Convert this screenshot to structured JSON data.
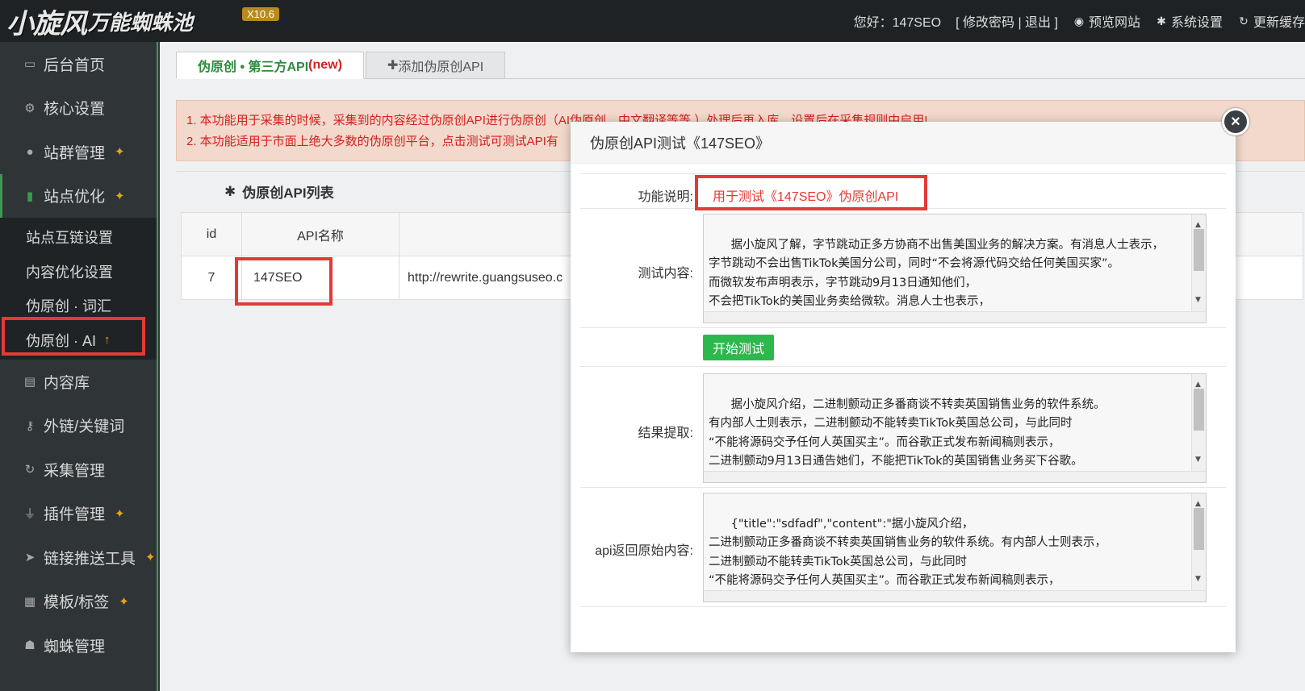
{
  "header": {
    "logo_main": "小旋风",
    "logo_sub": "万能蜘蛛池",
    "version": "X10.6",
    "greeting": "您好：147SEO",
    "account_links": "[ 修改密码 | 退出 ]",
    "preview": "预览网站",
    "settings": "系统设置",
    "refresh": "更新缓存"
  },
  "sidebar": {
    "items": [
      {
        "label": "后台首页",
        "icon": "monitor-icon"
      },
      {
        "label": "核心设置",
        "icon": "gear-icon"
      },
      {
        "label": "站群管理",
        "icon": "user-icon",
        "pinned": true
      },
      {
        "label": "站点优化",
        "icon": "bar-chart-icon",
        "pinned": true
      },
      {
        "label": "内容库",
        "icon": "document-icon"
      },
      {
        "label": "外链/关键词",
        "icon": "key-icon"
      },
      {
        "label": "采集管理",
        "icon": "refresh-icon"
      },
      {
        "label": "插件管理",
        "icon": "plug-icon",
        "pinned": true
      },
      {
        "label": "链接推送工具",
        "icon": "send-icon",
        "pinned": true
      },
      {
        "label": "模板/标签",
        "icon": "windows-icon",
        "pinned": true
      },
      {
        "label": "蜘蛛管理",
        "icon": "android-icon"
      }
    ],
    "sub_items": [
      {
        "label": "站点互链设置"
      },
      {
        "label": "内容优化设置"
      },
      {
        "label": "伪原创 · 词汇"
      },
      {
        "label": "伪原创 · AI",
        "marker": "↑"
      }
    ]
  },
  "tabs": {
    "active_prefix": "伪原创 • 第三方API",
    "active_new": "(new)",
    "add": "添加伪原创API"
  },
  "notice": {
    "line1": "1. 本功能用于采集的时候，采集到的内容经过伪原创API进行伪原创（AI伪原创、中文翻译等等 ）处理后再入库，设置后在采集规则中启用!",
    "line2": "2. 本功能适用于市面上绝大多数的伪原创平台，点击测试可测试API有"
  },
  "api_list": {
    "title": "伪原创API列表",
    "headers": {
      "id": "id",
      "name": "API名称"
    },
    "rows": [
      {
        "id": "7",
        "name": "147SEO",
        "url": "http://rewrite.guangsuseo.c"
      }
    ]
  },
  "modal": {
    "title": "伪原创API测试《147SEO》",
    "func_label": "功能说明:",
    "func_value": "用于测试《147SEO》伪原创API",
    "test_label": "测试内容:",
    "test_content": "据小旋风了解，字节跳动正多方协商不出售美国业务的解决方案。有消息人士表示，\n字节跳动不会出售TikTok美国分公司，同时“不会将源代码交给任何美国买家”。\n而微软发布声明表示，字节跳动9月13日通知他们，\n不会把TikTok的美国业务卖给微软。消息人士也表示，\n也不会将TikTok美国分公司出售给甲骨文。",
    "start_button": "开始测试",
    "result_label": "结果提取:",
    "result_content": "据小旋风介绍，二进制颤动正多番商谈不转卖英国销售业务的软件系统。\n有内部人士则表示，二进制颤动不能转卖TikTok英国总公司，与此同时\n“不能将源码交予任何人英国买主”。而谷歌正式发布新闻稿则表示，\n二进制颤动9月13日通告她们，不能把TikTok的英国销售业务买下谷歌。\n内部人士也则表示，也不能将TikTok英国总公司转买下余文。",
    "raw_label": "api返回原始内容:",
    "raw_content": "{\"title\":\"sdfadf\",\"content\":\"据小旋风介绍，\n二进制颤动正多番商谈不转卖英国销售业务的软件系统。有内部人士则表示，\n二进制颤动不能转卖TikTok英国总公司，与此同时\n“不能将源码交予任何人英国买主”。而谷歌正式发布新闻稿则表示，\n二进制颤动9月13日通告她们，不能把TikTok的英国销售业务买下谷歌。",
    "close": "×"
  }
}
